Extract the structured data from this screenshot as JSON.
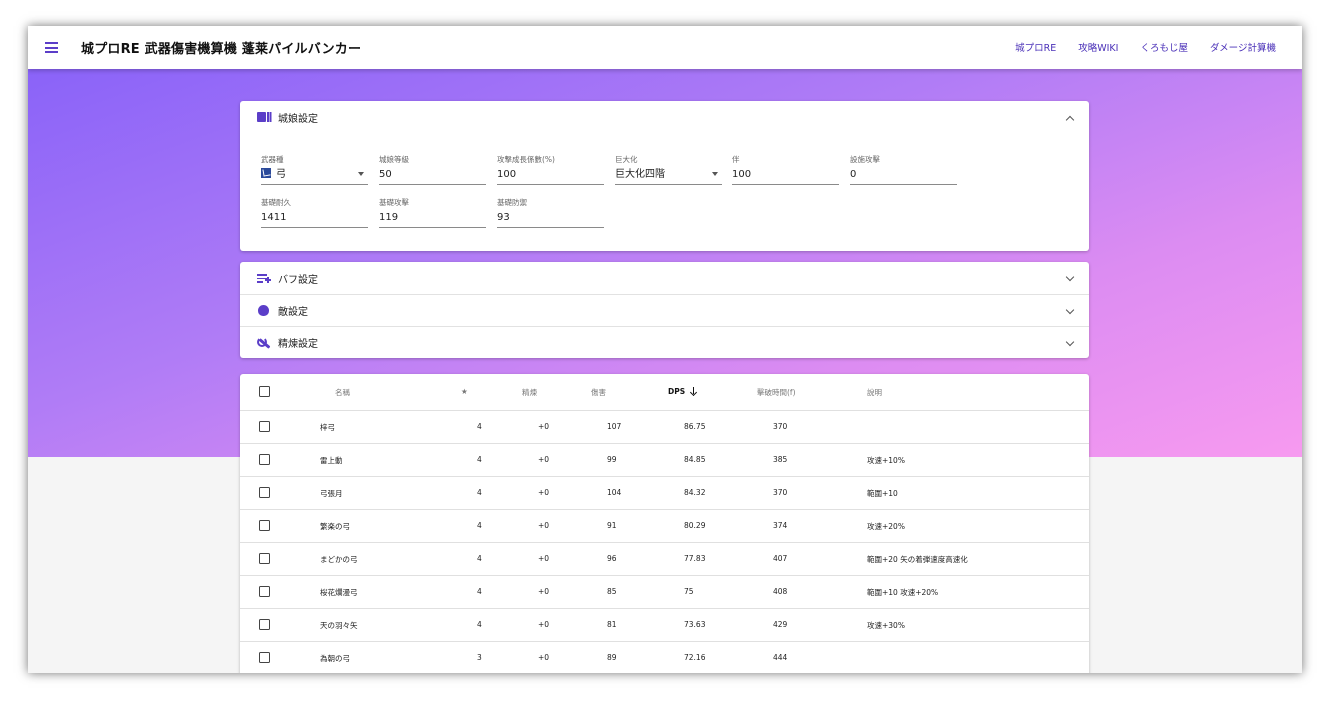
{
  "appbar": {
    "title": "城プロRE 武器傷害機算機 蓬莱パイルバンカー",
    "nav": [
      "城プロRE",
      "攻略WIKI",
      "くろもじ屋",
      "ダメージ計算機"
    ]
  },
  "settings": {
    "title": "城娘設定",
    "fields": {
      "weapon": {
        "label": "武器種",
        "value": "弓"
      },
      "level": {
        "label": "城娘等級",
        "value": "50"
      },
      "growth": {
        "label": "攻撃成長係數(%)",
        "value": "100"
      },
      "giant": {
        "label": "巨大化",
        "value": "巨大化四階"
      },
      "bond": {
        "label": "伴",
        "value": "100"
      },
      "facility": {
        "label": "設施攻擊",
        "value": "0"
      },
      "hp": {
        "label": "基礎耐久",
        "value": "1411"
      },
      "atk": {
        "label": "基礎攻擊",
        "value": "119"
      },
      "def": {
        "label": "基礎防禦",
        "value": "93"
      }
    }
  },
  "panels": [
    "バフ設定",
    "敵設定",
    "精煉設定"
  ],
  "table": {
    "headers": {
      "name": "名稱",
      "star": "★",
      "refine": "精煉",
      "damage": "傷害",
      "dps": "DPS",
      "time": "擊破時間(f)",
      "desc": "說明"
    },
    "rows": [
      {
        "name": "梓弓",
        "star": "4",
        "refine": "+0",
        "damage": "107",
        "dps": "86.75",
        "time": "370",
        "desc": ""
      },
      {
        "name": "雷上動",
        "star": "4",
        "refine": "+0",
        "damage": "99",
        "dps": "84.85",
        "time": "385",
        "desc": "攻速+10%"
      },
      {
        "name": "弓張月",
        "star": "4",
        "refine": "+0",
        "damage": "104",
        "dps": "84.32",
        "time": "370",
        "desc": "範圍+10"
      },
      {
        "name": "繁楽の弓",
        "star": "4",
        "refine": "+0",
        "damage": "91",
        "dps": "80.29",
        "time": "374",
        "desc": "攻速+20%"
      },
      {
        "name": "まどかの弓",
        "star": "4",
        "refine": "+0",
        "damage": "96",
        "dps": "77.83",
        "time": "407",
        "desc": "範圍+20 矢の着弾速度高速化"
      },
      {
        "name": "桜花爛漫弓",
        "star": "4",
        "refine": "+0",
        "damage": "85",
        "dps": "75",
        "time": "408",
        "desc": "範圍+10 攻速+20%"
      },
      {
        "name": "天の羽々矢",
        "star": "4",
        "refine": "+0",
        "damage": "81",
        "dps": "73.63",
        "time": "429",
        "desc": "攻速+30%"
      },
      {
        "name": "為朝の弓",
        "star": "3",
        "refine": "+0",
        "damage": "89",
        "dps": "72.16",
        "time": "444",
        "desc": ""
      }
    ]
  },
  "colors": {
    "accent": "#5b3ec8",
    "gradient_start": "#8a63f8",
    "gradient_end": "#f79af0"
  }
}
